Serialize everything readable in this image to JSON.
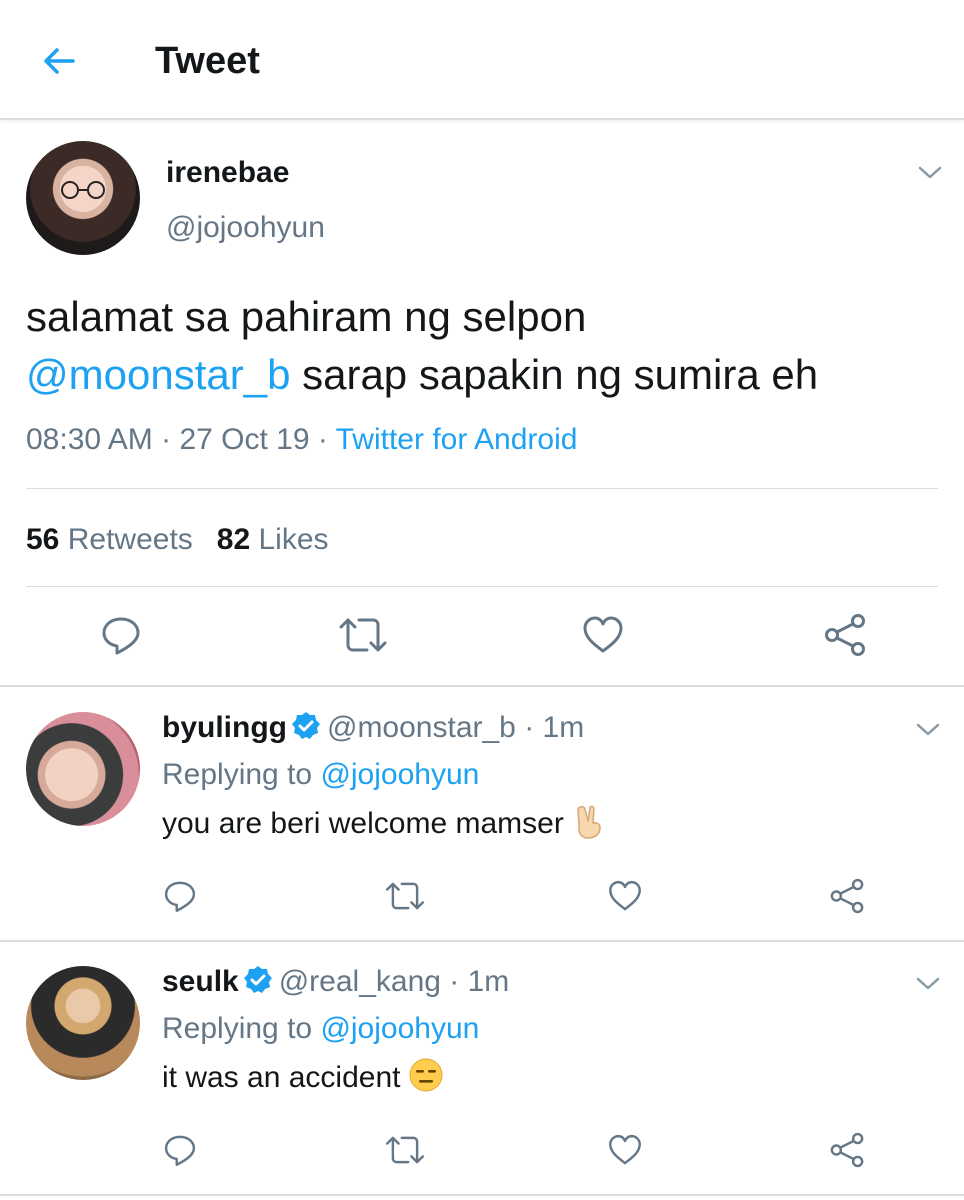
{
  "header": {
    "title": "Tweet"
  },
  "tweet": {
    "display_name": "irenebae",
    "handle": "@jojoohyun",
    "text_line1": "salamat sa pahiram ng selpon",
    "mention": "@moonstar_b",
    "text_rest": " sarap sapakin ng sumira eh",
    "time": "08:30 AM",
    "sep1": " · ",
    "date": "27 Oct 19",
    "sep2": " · ",
    "source": "Twitter for Android",
    "retweets_count": "56",
    "retweets_label": "Retweets",
    "likes_count": "82",
    "likes_label": "Likes"
  },
  "replies": [
    {
      "name": "byulingg",
      "handle": "@moonstar_b",
      "time": " · 1m",
      "replying_prefix": "Replying to ",
      "replying_to": "@jojoohyun",
      "text": "you are beri welcome mamser",
      "emoji": "victory-hand-emoji",
      "verified": true
    },
    {
      "name": "seulk",
      "handle": "@real_kang",
      "time": " · 1m",
      "replying_prefix": "Replying to ",
      "replying_to": "@jojoohyun",
      "text": "it was an accident",
      "emoji": "expressionless-face-emoji",
      "verified": true
    }
  ],
  "colors": {
    "accent": "#1da1f2",
    "secondary_text": "#657786",
    "icon_gray": "#657786",
    "divider": "#d8dde1"
  },
  "icons": [
    "back-arrow-icon",
    "chevron-down-icon",
    "reply-icon",
    "retweet-icon",
    "like-icon",
    "share-icon",
    "verified-badge-icon"
  ]
}
